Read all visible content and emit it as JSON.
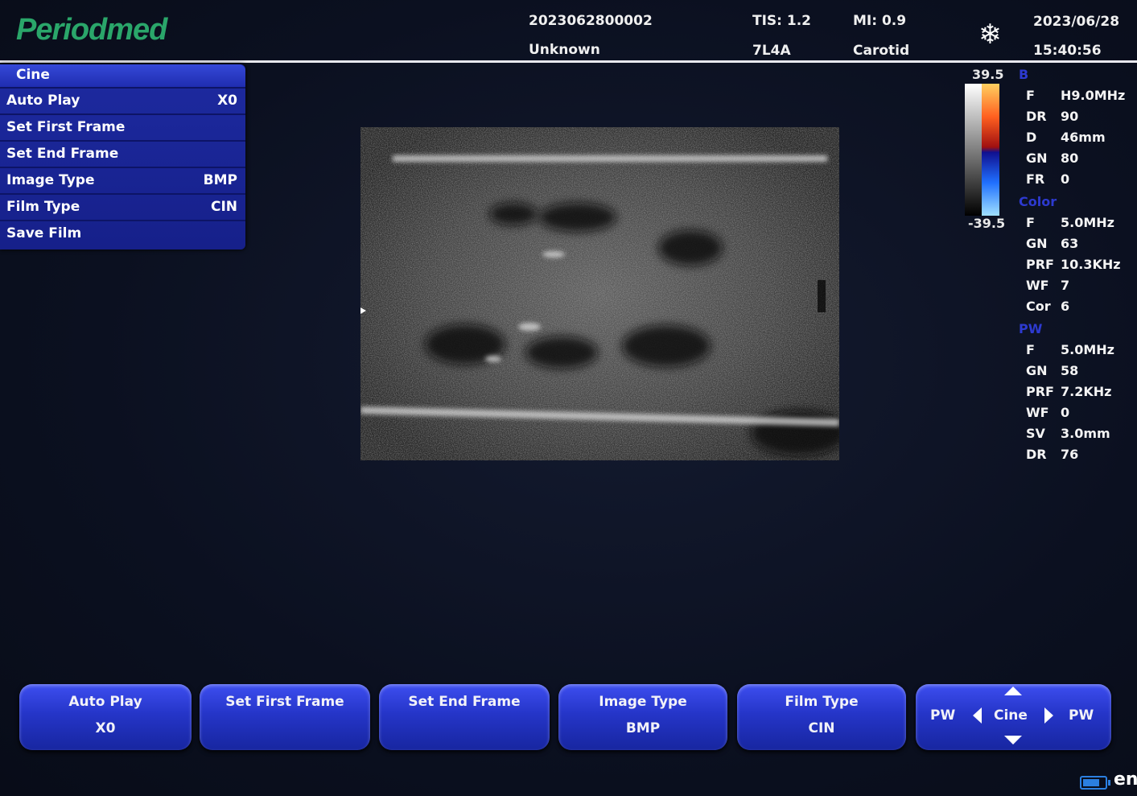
{
  "header": {
    "logo": "Periodmed",
    "patient_id": "2023062800002",
    "patient_name": "Unknown",
    "tis": "TIS: 1.2",
    "probe": "7L4A",
    "mi": "MI: 0.9",
    "preset": "Carotid",
    "date": "2023/06/28",
    "time": "15:40:56",
    "freeze_icon": "snowflake-icon"
  },
  "cine_menu": {
    "title": "Cine",
    "items": [
      {
        "label": "Auto Play",
        "value": "X0"
      },
      {
        "label": "Set First Frame",
        "value": ""
      },
      {
        "label": "Set End Frame",
        "value": ""
      },
      {
        "label": "Image Type",
        "value": "BMP"
      },
      {
        "label": "Film Type",
        "value": "CIN"
      },
      {
        "label": "Save Film",
        "value": ""
      }
    ]
  },
  "scale": {
    "max": "39.5",
    "min": "-39.5"
  },
  "params": {
    "b": {
      "title": "B",
      "rows": [
        {
          "k": "F",
          "v": "H9.0MHz"
        },
        {
          "k": "DR",
          "v": "90"
        },
        {
          "k": "D",
          "v": "46mm"
        },
        {
          "k": "GN",
          "v": "80"
        },
        {
          "k": "FR",
          "v": "0"
        }
      ]
    },
    "color": {
      "title": "Color",
      "rows": [
        {
          "k": "F",
          "v": "5.0MHz"
        },
        {
          "k": "GN",
          "v": "63"
        },
        {
          "k": "PRF",
          "v": "10.3KHz"
        },
        {
          "k": "WF",
          "v": "7"
        },
        {
          "k": "Cor",
          "v": "6"
        }
      ]
    },
    "pw": {
      "title": "PW",
      "rows": [
        {
          "k": "F",
          "v": "5.0MHz"
        },
        {
          "k": "GN",
          "v": "58"
        },
        {
          "k": "PRF",
          "v": "7.2KHz"
        },
        {
          "k": "WF",
          "v": "0"
        },
        {
          "k": "SV",
          "v": "3.0mm"
        },
        {
          "k": "DR",
          "v": "76"
        }
      ]
    }
  },
  "softkeys": [
    {
      "label": "Auto Play",
      "value": "X0"
    },
    {
      "label": "Set First Frame",
      "value": ""
    },
    {
      "label": "Set End Frame",
      "value": ""
    },
    {
      "label": "Image Type",
      "value": "BMP"
    },
    {
      "label": "Film Type",
      "value": "CIN"
    }
  ],
  "nav": {
    "left": "PW",
    "center": "Cine",
    "right": "PW"
  },
  "status": {
    "lang": "en",
    "battery_level": 0.75
  },
  "colors": {
    "menu": "#1d2aa0",
    "accent": "#2d3ad0",
    "logo": "#2aa66a",
    "battery": "#2b7fe0"
  }
}
